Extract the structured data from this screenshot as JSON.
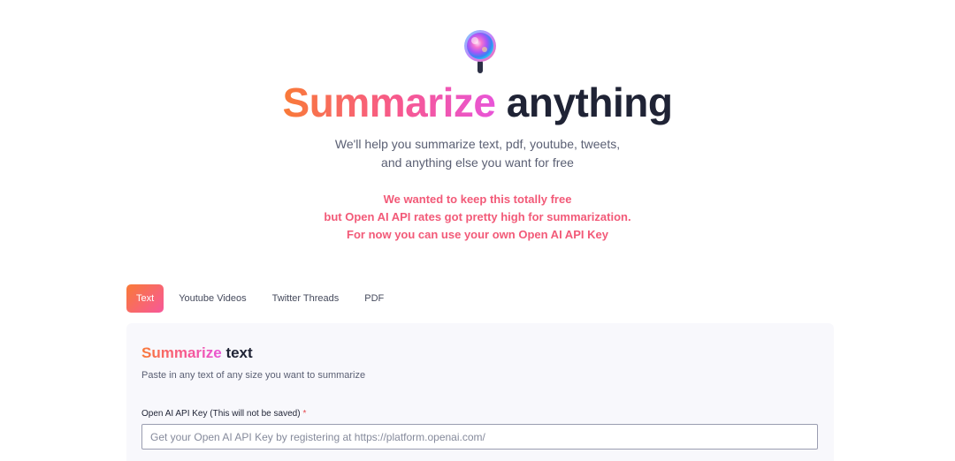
{
  "logo": {
    "icon": "magnifier-logo-icon"
  },
  "hero": {
    "title_highlight": "Summarize",
    "title_rest": "anything",
    "subtitle_line1": "We'll help you summarize text, pdf, youtube, tweets,",
    "subtitle_line2": "and anything else you want for free"
  },
  "notice": {
    "line1": "We wanted to keep this totally free",
    "line2": "but Open AI API rates got pretty high for summarization.",
    "line3": "For now you can use your own Open AI API Key"
  },
  "tabs": [
    {
      "label": "Text",
      "active": true
    },
    {
      "label": "Youtube Videos",
      "active": false
    },
    {
      "label": "Twitter Threads",
      "active": false
    },
    {
      "label": "PDF",
      "active": false
    }
  ],
  "panel": {
    "title_highlight": "Summarize",
    "title_rest": "text",
    "description": "Paste in any text of any size you want to summarize",
    "api_key": {
      "label": "Open AI API Key (This will not be saved)",
      "required_mark": "*",
      "value": "",
      "placeholder": "Get your Open AI API Key by registering at https://platform.openai.com/"
    }
  },
  "colors": {
    "accent_orange": "#f97a37",
    "accent_pink": "#f7588f",
    "accent_magenta": "#e855d8",
    "notice_text": "#f25a78",
    "required": "#e5484d"
  }
}
